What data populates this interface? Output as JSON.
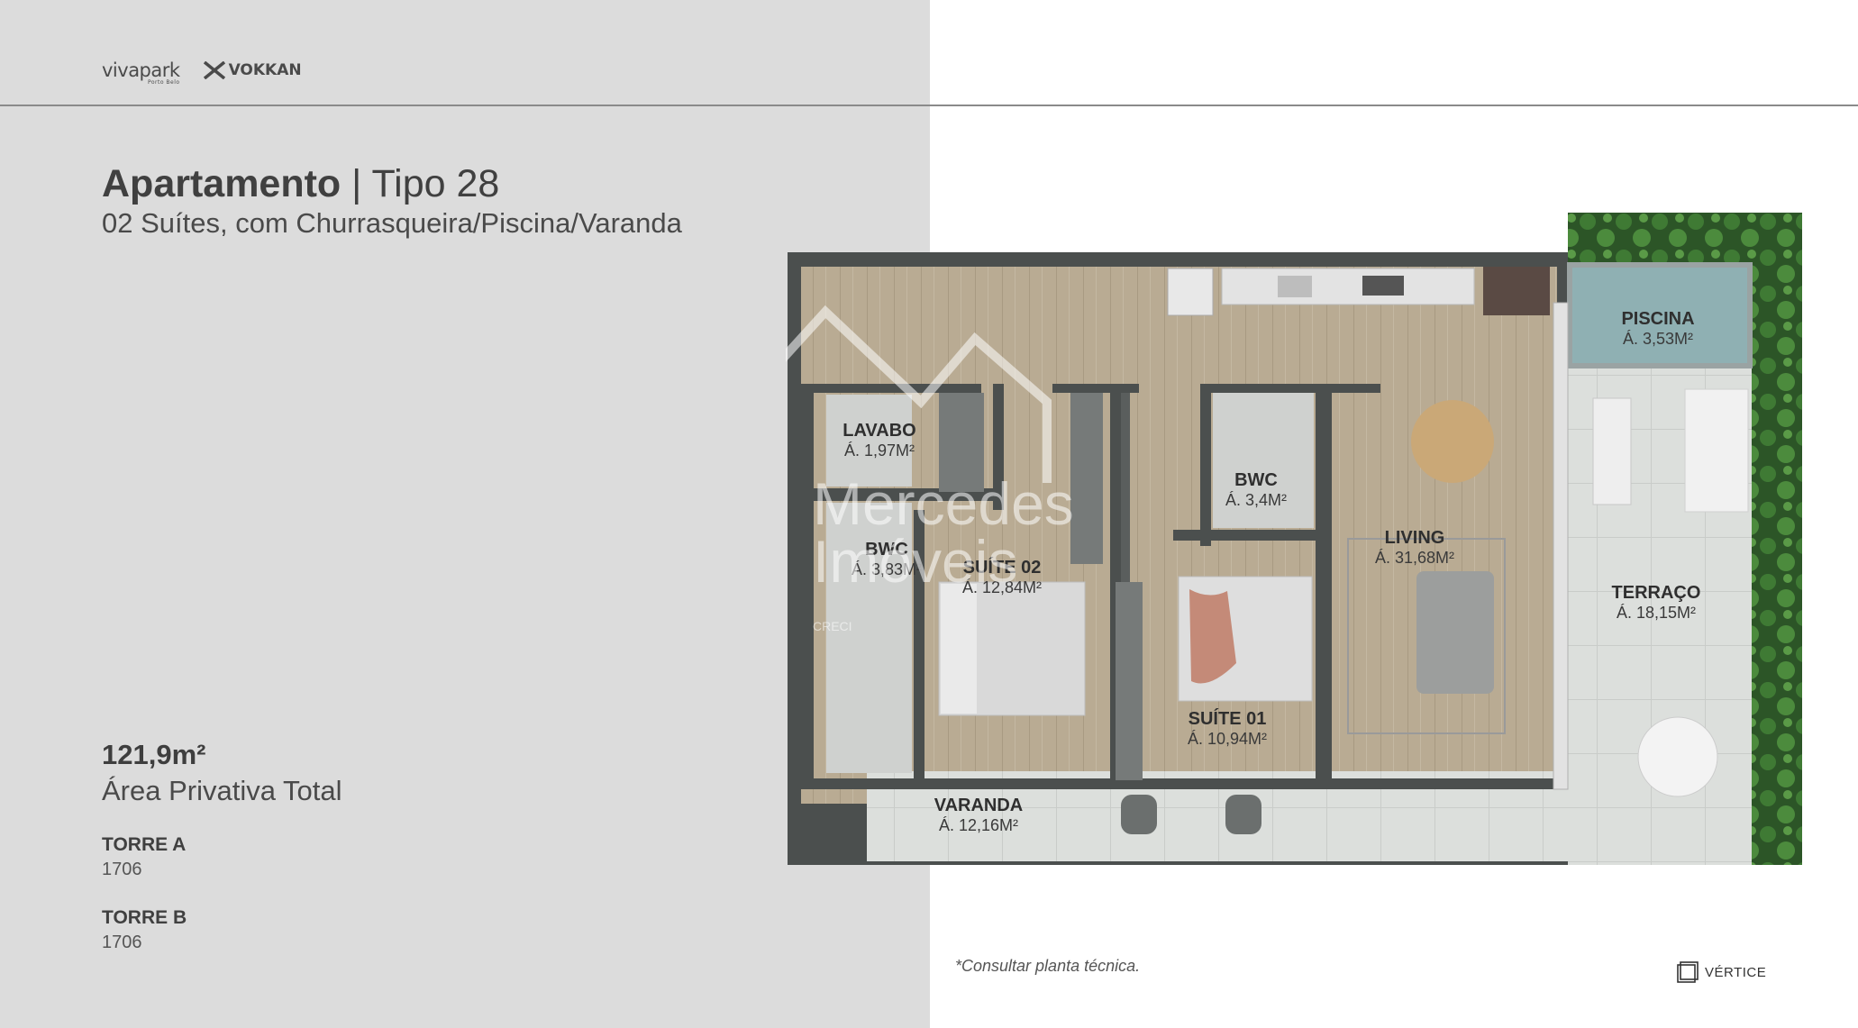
{
  "brand": {
    "vivapark": "vivapark",
    "vivapark_sub": "Porto Belo",
    "vokkan": "VOKKAN",
    "vertice": "VÉRTICE"
  },
  "header": {
    "title_bold": "Apartamento",
    "title_rest": " | Tipo 28",
    "subtitle": "02 Suítes, com Churrasqueira/Piscina/Varanda"
  },
  "summary": {
    "area_value": "121,9m²",
    "area_label": "Área Privativa Total"
  },
  "towers": [
    {
      "label": "TORRE A",
      "unit": "1706"
    },
    {
      "label": "TORRE B",
      "unit": "1706"
    }
  ],
  "footnote": "*Consultar planta técnica.",
  "watermark": {
    "line1": "Mercedes",
    "line2": "Imóveis",
    "line3": "CRECI"
  },
  "rooms": {
    "lavabo": {
      "name": "LAVABO",
      "area": "Á. 1,97M²"
    },
    "bwc2": {
      "name": "BWC",
      "area": "Á. 3,83M²"
    },
    "suite2": {
      "name": "SUÍTE 02",
      "area": "Á. 12,84M²"
    },
    "bwc1": {
      "name": "BWC",
      "area": "Á. 3,4M²"
    },
    "suite1": {
      "name": "SUÍTE 01",
      "area": "Á. 10,94M²"
    },
    "living": {
      "name": "LIVING",
      "area": "Á. 31,68M²"
    },
    "piscina": {
      "name": "PISCINA",
      "area": "Á. 3,53M²"
    },
    "terraco": {
      "name": "TERRAÇO",
      "area": "Á. 18,15M²"
    },
    "varanda": {
      "name": "VARANDA",
      "area": "Á. 12,16M²"
    }
  },
  "colors": {
    "panel": "#dcdcdc",
    "wall": "#4b4f4e",
    "floor_wood": "#b7a890",
    "pool": "#8fb0b3",
    "garden": "#2f5a2a"
  }
}
